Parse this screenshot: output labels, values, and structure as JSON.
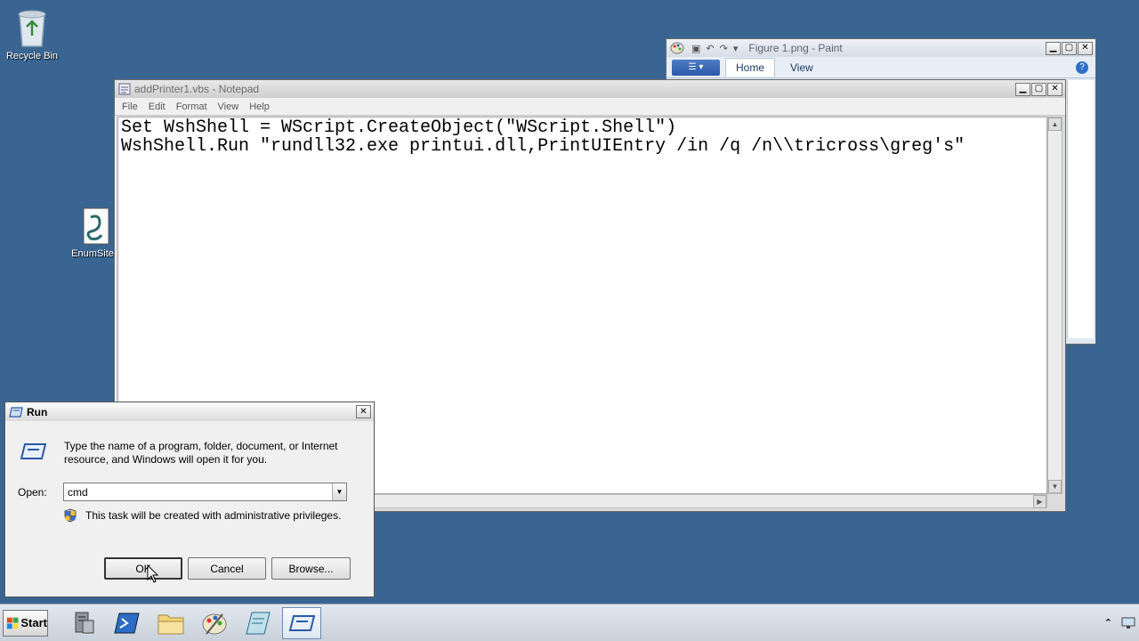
{
  "desktop": {
    "icons": [
      {
        "label": "Recycle Bin",
        "icon": "recycle-bin-icon"
      },
      {
        "label": "EnumSiteN",
        "icon": "script-file-icon"
      }
    ]
  },
  "paint": {
    "title": "Figure 1.png - Paint",
    "tabs": [
      "Home",
      "View"
    ],
    "selected_tab": "Home"
  },
  "notepad": {
    "title": "addPrinter1.vbs - Notepad",
    "menu": [
      "File",
      "Edit",
      "Format",
      "View",
      "Help"
    ],
    "content": "Set WshShell = WScript.CreateObject(\"WScript.Shell\")\nWshShell.Run \"rundll32.exe printui.dll,PrintUIEntry /in /q /n\\\\tricross\\greg's\""
  },
  "run_dialog": {
    "title": "Run",
    "description": "Type the name of a program, folder, document, or Internet resource, and Windows will open it for you.",
    "open_label": "Open:",
    "open_value": "cmd",
    "admin_note": "This task will be created with administrative privileges.",
    "ok_label": "OK",
    "cancel_label": "Cancel",
    "browse_label": "Browse..."
  },
  "taskbar": {
    "start_label": "Start",
    "apps": [
      "server-manager-icon",
      "powershell-icon",
      "explorer-folder-icon",
      "paint-icon",
      "notepad-icon",
      "run-icon"
    ],
    "active_app": "run-icon"
  },
  "colors": {
    "desktop": "#3a6592",
    "taskbar": "#d3dae3"
  }
}
